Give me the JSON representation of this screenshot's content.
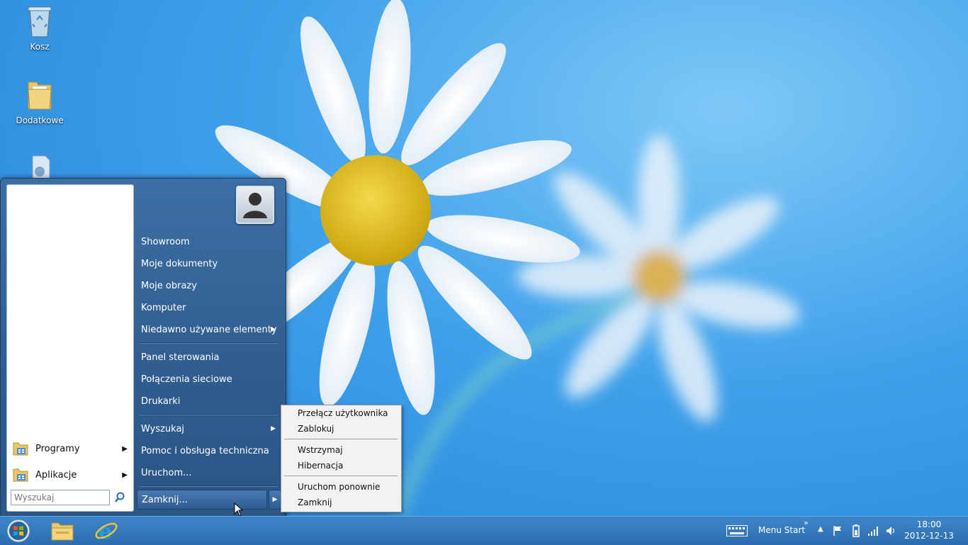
{
  "desktop": {
    "icons": [
      {
        "label": "Kosz"
      },
      {
        "label": "Dodatkowe"
      }
    ]
  },
  "start_menu": {
    "left_items": [
      {
        "label": "Programy"
      },
      {
        "label": "Aplikacje"
      }
    ],
    "search": {
      "placeholder": "Wyszukaj"
    },
    "right_items": [
      {
        "label": "Showroom"
      },
      {
        "label": "Moje dokumenty"
      },
      {
        "label": "Moje obrazy"
      },
      {
        "label": "Komputer"
      },
      {
        "label": "Niedawno używane elementy"
      },
      {
        "label": "Panel sterowania"
      },
      {
        "label": "Połączenia sieciowe"
      },
      {
        "label": "Drukarki"
      },
      {
        "label": "Wyszukaj"
      },
      {
        "label": "Pomoc i obsługa techniczna"
      },
      {
        "label": "Uruchom..."
      }
    ],
    "shutdown_label": "Zamknij..."
  },
  "shutdown_menu": {
    "items": [
      {
        "label": "Przełącz użytkownika"
      },
      {
        "label": "Zablokuj"
      },
      {
        "label": "Wstrzymaj"
      },
      {
        "label": "Hibernacja"
      },
      {
        "label": "Uruchom ponownie"
      },
      {
        "label": "Zamknij"
      }
    ]
  },
  "taskbar": {
    "toolbar_label": "Menu Start",
    "toolbar_chevron": "»",
    "clock": {
      "time": "18:00",
      "date": "2012-12-13"
    }
  },
  "colors": {
    "start_menu_bg": "#2f5c8f",
    "taskbar_bg": "#2b6db0",
    "wallpaper": "#3fa0ea"
  }
}
